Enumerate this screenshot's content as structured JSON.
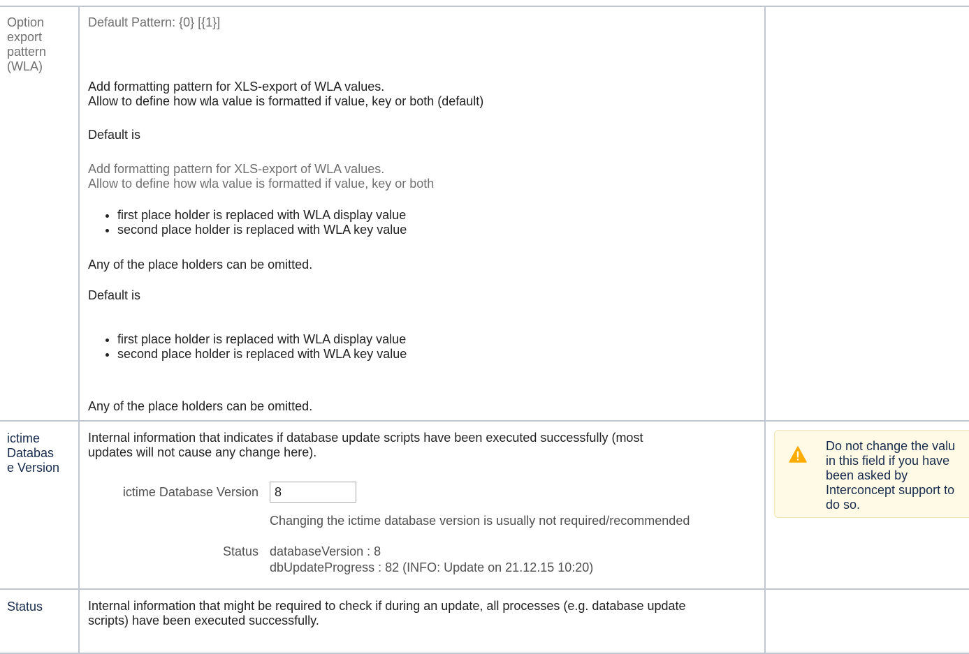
{
  "rows": [
    {
      "label": [
        "Option",
        "export",
        "pattern",
        "(WLA)"
      ],
      "default_pattern": "Default Pattern: {0} [{1}]",
      "desc_line1": "Add formatting pattern for XLS-export of WLA values.",
      "desc_line2": "Allow to define how wla value is formatted if value, key or both (default)",
      "default_is_1": "Default is",
      "gray_line1": "Add formatting pattern for XLS-export of WLA values.",
      "gray_line2": "Allow to define how wla value is formatted if value, key or both",
      "bullets": [
        "first place holder is replaced with WLA display value",
        "second place holder is replaced with WLA key value"
      ],
      "omit_1": "Any of the place holders can be omitted.",
      "default_is_2": "Default is",
      "bullets2": [
        "first place holder is replaced with WLA display value",
        "second place holder is replaced with WLA key value"
      ],
      "omit_2": "Any of the place holders can be omitted."
    },
    {
      "label": [
        "ictime",
        "Databas",
        "e Version"
      ],
      "desc_line1": "Internal information that indicates if database update scripts have been executed successfully (most",
      "desc_line2": "updates will not cause any change here).",
      "form": {
        "field_label": "ictime Database Version",
        "field_value": "8",
        "hint": "Changing the ictime database version is usually not required/recommended",
        "status_label": "Status",
        "status_line1": "databaseVersion : 8",
        "status_line2": "dbUpdateProgress : 82 (INFO: Update on 21.12.15 10:20)"
      },
      "note": {
        "icon": "warning-icon",
        "lines": [
          "Do not change the valu",
          "in this field if you have",
          "been asked by",
          "Interconcept support to",
          "do so."
        ]
      }
    },
    {
      "label": [
        "Status"
      ],
      "desc_line1": "Internal information that might be required to check if during an update, all processes (e.g. database update",
      "desc_line2": "scripts) have been executed successfully."
    }
  ],
  "colors": {
    "border": "#c1c7d0",
    "note_bg": "#fffae6",
    "warning": "#ffab00"
  }
}
